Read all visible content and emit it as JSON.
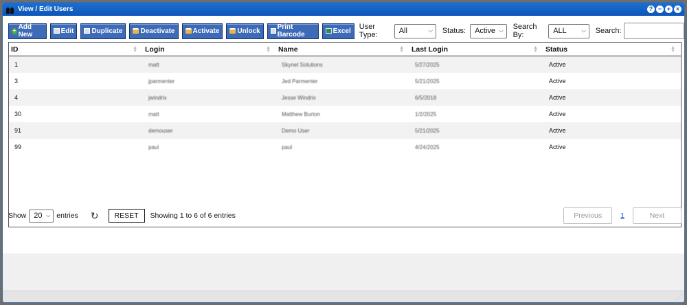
{
  "window": {
    "title": "View / Edit Users",
    "title_icon": "users-icon",
    "controls": [
      "help-icon",
      "minimize-icon",
      "maximize-icon",
      "close-icon"
    ]
  },
  "toolbar": {
    "buttons": [
      {
        "label": "Add New",
        "icon": "plus-icon"
      },
      {
        "label": "Edit",
        "icon": "edit-icon"
      },
      {
        "label": "Duplicate",
        "icon": "duplicate-icon"
      },
      {
        "label": "Deactivate",
        "icon": "lock-icon"
      },
      {
        "label": "Activate",
        "icon": "unlock-icon"
      },
      {
        "label": "Unlock",
        "icon": "unlock-icon"
      },
      {
        "label": "Print Barcode",
        "icon": "barcode-icon"
      },
      {
        "label": "Excel",
        "icon": "excel-icon"
      }
    ],
    "filters": {
      "user_type_label": "User Type:",
      "user_type_value": "All",
      "status_label": "Status:",
      "status_value": "Active",
      "search_by_label": "Search By:",
      "search_by_value": "ALL",
      "search_label": "Search:",
      "search_value": ""
    }
  },
  "table": {
    "columns": [
      "ID",
      "Login",
      "Name",
      "Last Login",
      "Status"
    ],
    "rows": [
      [
        "1",
        "matt",
        "Skynet Solutions",
        "5/27/2025",
        "Active"
      ],
      [
        "3",
        "jparmenter",
        "Jed Parmenter",
        "5/21/2025",
        "Active"
      ],
      [
        "4",
        "jwindrix",
        "Jesse Windrix",
        "6/5/2018",
        "Active"
      ],
      [
        "30",
        "matt",
        "Matthew Burton",
        "1/2/2025",
        "Active"
      ],
      [
        "91",
        "demouser",
        "Demo User",
        "5/21/2025",
        "Active"
      ],
      [
        "99",
        "paul",
        "paul",
        "4/24/2025",
        "Active"
      ]
    ]
  },
  "footer": {
    "show_label": "Show",
    "page_size": "20",
    "entries_label": "entries",
    "reset_label": "RESET",
    "info": "Showing 1 to 6 of 6 entries",
    "prev_label": "Previous",
    "page": "1",
    "next_label": "Next"
  },
  "colors": {
    "titlebar": "#0b56b8",
    "button": "#3d6bb8",
    "link": "#1a4fd6"
  }
}
